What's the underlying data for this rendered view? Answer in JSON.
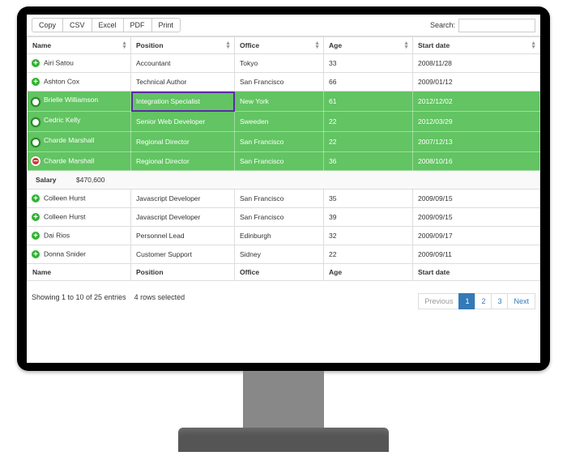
{
  "toolbar": {
    "buttons": [
      "Copy",
      "CSV",
      "Excel",
      "PDF",
      "Print"
    ],
    "search_label": "Search:"
  },
  "columns": [
    "Name",
    "Position",
    "Office",
    "Age",
    "Start date"
  ],
  "rows": [
    {
      "name": "Airi Satou",
      "position": "Accountant",
      "office": "Tokyo",
      "age": "33",
      "start": "2008/11/28",
      "selected": false,
      "expanded": false
    },
    {
      "name": "Ashton Cox",
      "position": "Technical Author",
      "office": "San Francisco",
      "age": "66",
      "start": "2009/01/12",
      "selected": false,
      "expanded": false
    },
    {
      "name": "Brielle Williamson",
      "position": "Integration Specialist",
      "office": "New York",
      "age": "61",
      "start": "2012/12/02",
      "selected": true,
      "expanded": false,
      "focus": true
    },
    {
      "name": "Cedric Kelly",
      "position": "Senior Web Developer",
      "office": "Sweeden",
      "age": "22",
      "start": "2012/03/29",
      "selected": true,
      "expanded": false
    },
    {
      "name": "Charde Marshall",
      "position": "Regional Director",
      "office": "San Francisco",
      "age": "22",
      "start": "2007/12/13",
      "selected": true,
      "expanded": false
    },
    {
      "name": "Charde Marshall",
      "position": "Regional Director",
      "office": "San Francisco",
      "age": "36",
      "start": "2008/10/16",
      "selected": true,
      "expanded": true,
      "child": {
        "label": "Salary",
        "value": "$470,600"
      }
    },
    {
      "name": "Colleen Hurst",
      "position": "Javascript Developer",
      "office": "San Francisco",
      "age": "35",
      "start": "2009/09/15",
      "selected": false,
      "expanded": false
    },
    {
      "name": "Colleen Hurst",
      "position": "Javascript Developer",
      "office": "San Francisco",
      "age": "39",
      "start": "2009/09/15",
      "selected": false,
      "expanded": false
    },
    {
      "name": "Dai Rios",
      "position": "Personnel Lead",
      "office": "Edinburgh",
      "age": "32",
      "start": "2009/09/17",
      "selected": false,
      "expanded": false
    },
    {
      "name": "Donna Snider",
      "position": "Customer Support",
      "office": "Sidney",
      "age": "22",
      "start": "2009/09/11",
      "selected": false,
      "expanded": false
    }
  ],
  "footer_cols": [
    "Name",
    "Position",
    "Office",
    "Age",
    "Start date"
  ],
  "info": "Showing 1 to 10 of 25 entries",
  "selected_info": "4 rows selected",
  "pagination": {
    "prev": "Previous",
    "next": "Next",
    "pages": [
      "1",
      "2",
      "3"
    ],
    "active": "1"
  }
}
